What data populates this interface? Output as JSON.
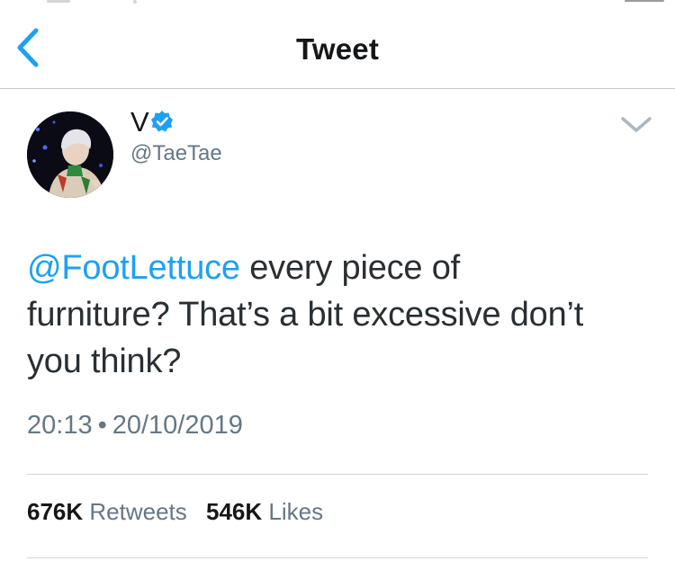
{
  "header": {
    "title": "Tweet"
  },
  "tweet": {
    "author": {
      "name": "V",
      "handle": "@TaeTae",
      "verified": true
    },
    "mention": "@FootLettuce",
    "text_line1": " every piece of",
    "text_line2": "furniture? That’s a bit excessive don’t",
    "text_line3": "you think?",
    "time": "20:13",
    "separator": "•",
    "date": "20/10/2019"
  },
  "stats": {
    "retweets_count": "676K",
    "retweets_label": "Retweets",
    "likes_count": "546K",
    "likes_label": "Likes"
  },
  "icons": {
    "back": "chevron-left-icon",
    "verified": "verified-badge-icon",
    "menu": "chevron-down-icon"
  },
  "colors": {
    "accent": "#1da1f2",
    "text": "#14171a",
    "secondary": "#657786"
  }
}
